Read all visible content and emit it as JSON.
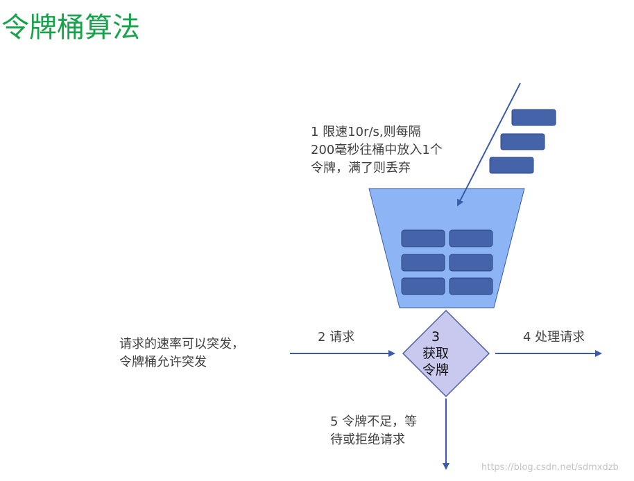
{
  "title": "令牌桶算法",
  "steps": {
    "s1": {
      "lines": [
        "1  限速10r/s,则每隔",
        "200毫秒往桶中放入1个",
        "令牌，满了则丢弃"
      ]
    },
    "s2": {
      "label": "2  请求"
    },
    "s3": {
      "lines": [
        "3",
        "获取",
        "令牌"
      ]
    },
    "s4": {
      "label": "4  处理请求"
    },
    "s5": {
      "lines": [
        "5  令牌不足，等",
        "待或拒绝请求"
      ]
    }
  },
  "burst_note": {
    "lines": [
      "请求的速率可以突发，",
      "令牌桶允许突发"
    ]
  },
  "watermark": "https://blog.csdn.net/sdmxdzb",
  "colors": {
    "title": "#16a34a",
    "bucket_fill": "#8db4f4",
    "bucket_stroke": "#3a5ba0",
    "token_fill": "#4463a9",
    "token_stroke": "#2d4687",
    "diamond_fill": "#c9c9ef",
    "diamond_stroke": "#4a5ea0",
    "arrow": "#3b5aa8"
  }
}
